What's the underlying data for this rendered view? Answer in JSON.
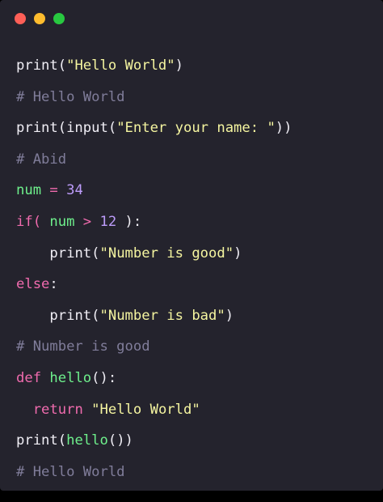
{
  "window": {
    "controls": [
      {
        "name": "close-button",
        "color": "#fe5f57"
      },
      {
        "name": "minimize-button",
        "color": "#febc2e"
      },
      {
        "name": "zoom-button",
        "color": "#28c840"
      }
    ]
  },
  "code": {
    "lines": [
      {
        "indent": 0,
        "tokens": [
          {
            "text": "print(",
            "type": "plain"
          },
          {
            "text": "\"Hello World\"",
            "type": "string"
          },
          {
            "text": ")",
            "type": "plain"
          }
        ]
      },
      {
        "indent": 0,
        "tokens": [
          {
            "text": "# Hello World",
            "type": "comment"
          }
        ]
      },
      {
        "indent": 0,
        "tokens": [
          {
            "text": "print(input(",
            "type": "plain"
          },
          {
            "text": "\"Enter your name: \"",
            "type": "string"
          },
          {
            "text": "))",
            "type": "plain"
          }
        ]
      },
      {
        "indent": 0,
        "tokens": [
          {
            "text": "# Abid",
            "type": "comment"
          }
        ]
      },
      {
        "indent": 0,
        "tokens": [
          {
            "text": "num",
            "type": "variable"
          },
          {
            "text": " = ",
            "type": "operator"
          },
          {
            "text": "34",
            "type": "number"
          }
        ]
      },
      {
        "indent": 0,
        "tokens": [
          {
            "text": "if(",
            "type": "keyword"
          },
          {
            "text": " ",
            "type": "plain"
          },
          {
            "text": "num",
            "type": "variable"
          },
          {
            "text": " > ",
            "type": "operator"
          },
          {
            "text": "12",
            "type": "number"
          },
          {
            "text": " ):",
            "type": "plain"
          }
        ]
      },
      {
        "indent": 4,
        "tokens": [
          {
            "text": "print(",
            "type": "plain"
          },
          {
            "text": "\"Number is good\"",
            "type": "string"
          },
          {
            "text": ")",
            "type": "plain"
          }
        ]
      },
      {
        "indent": 0,
        "tokens": [
          {
            "text": "else",
            "type": "keyword"
          },
          {
            "text": ":",
            "type": "plain"
          }
        ]
      },
      {
        "indent": 4,
        "tokens": [
          {
            "text": "print(",
            "type": "plain"
          },
          {
            "text": "\"Number is bad\"",
            "type": "string"
          },
          {
            "text": ")",
            "type": "plain"
          }
        ]
      },
      {
        "indent": 0,
        "tokens": [
          {
            "text": "# Number is good",
            "type": "comment"
          }
        ]
      },
      {
        "indent": 0,
        "tokens": [
          {
            "text": "def",
            "type": "keyword"
          },
          {
            "text": " ",
            "type": "plain"
          },
          {
            "text": "hello",
            "type": "function"
          },
          {
            "text": "():",
            "type": "plain"
          }
        ]
      },
      {
        "indent": 2,
        "tokens": [
          {
            "text": "return",
            "type": "keyword"
          },
          {
            "text": " ",
            "type": "plain"
          },
          {
            "text": "\"Hello World\"",
            "type": "string"
          }
        ]
      },
      {
        "indent": 0,
        "tokens": [
          {
            "text": "print(",
            "type": "plain"
          },
          {
            "text": "hello",
            "type": "function"
          },
          {
            "text": "())",
            "type": "plain"
          }
        ]
      },
      {
        "indent": 0,
        "tokens": [
          {
            "text": "# Hello World",
            "type": "comment"
          }
        ]
      }
    ]
  }
}
